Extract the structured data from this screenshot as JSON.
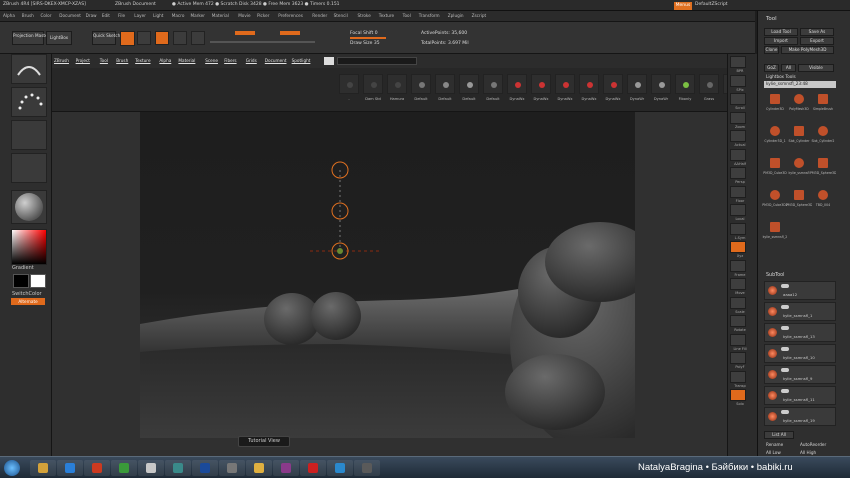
{
  "title_bar": {
    "app": "ZBrush 4R4 [SIRS-DKEX-XMCP-XZAS]",
    "doc": "ZBrush Document",
    "stats": "● Active Mem 472 ● Scratch Disk 3428 ● Free Mem 3623 ● Timers 0.151",
    "menus_button": "Menus",
    "default_script": "DefaultZScript"
  },
  "menu_bar": [
    "Alpha",
    "Brush",
    "Color",
    "Document",
    "Draw",
    "Edit",
    "File",
    "Layer",
    "Light",
    "Macro",
    "Marker",
    "Material",
    "Movie",
    "Picker",
    "Preferences",
    "Render",
    "Stencil",
    "Stroke",
    "Texture",
    "Tool",
    "Transform",
    "Zplugin",
    "Zscript"
  ],
  "toolbar": {
    "projection_master": "Projection Master",
    "lightbox": "LightBox",
    "quick_sketch": "Quick Sketch",
    "edit": "Edit",
    "draw": "Draw",
    "move": "Move",
    "scale": "Scale",
    "rotate": "Rotate",
    "focal_shift": "Focal Shift 0",
    "draw_size": "Draw Size 35",
    "active_points": "ActivePoints: 35,600",
    "total_points": "TotalPoints: 3.697 Mil"
  },
  "sub_palette": [
    "ZBrush",
    "Project",
    "Tool",
    "Brush",
    "Texture",
    "Alpha",
    "Material",
    "Scene",
    "Fibers",
    "Grids",
    "Document",
    "Spotlight"
  ],
  "brushes": [
    {
      "label": "-",
      "color": "#444444"
    },
    {
      "label": "Dam Std",
      "color": "#444444"
    },
    {
      "label": "Hamura",
      "color": "#444444"
    },
    {
      "label": "Default",
      "color": "#777777"
    },
    {
      "label": "Default",
      "color": "#888888"
    },
    {
      "label": "Default",
      "color": "#999999"
    },
    {
      "label": "Default",
      "color": "#777777"
    },
    {
      "label": "DynaWx",
      "color": "#cc3333"
    },
    {
      "label": "DynaWx",
      "color": "#cc3333"
    },
    {
      "label": "DynaWx",
      "color": "#cc3333"
    },
    {
      "label": "DynaWx",
      "color": "#cc3333"
    },
    {
      "label": "DynaWx",
      "color": "#cc3333"
    },
    {
      "label": "DynaWr",
      "color": "#999999"
    },
    {
      "label": "DynaWr",
      "color": "#999999"
    },
    {
      "label": "Fibonly",
      "color": "#7bc043"
    },
    {
      "label": "Grass",
      "color": "#666666"
    },
    {
      "label": "Grass",
      "color": "#666666"
    }
  ],
  "left_shelf": {
    "gradient": "Gradient",
    "switch_color": "SwitchColor",
    "alternate": "Alternate"
  },
  "right_shelf": [
    "BPR",
    "SPix",
    "Scroll",
    "Zoom",
    "Actual",
    "AAHalf",
    "Persp",
    "Floor",
    "Local",
    "L.Sym",
    "Xyz",
    "Frame",
    "Move",
    "Scale",
    "Rotate",
    "Line Fill",
    "PolyF",
    "Transp",
    "Solo"
  ],
  "tray": {
    "title": "Tool",
    "load_tool": "Load Tool",
    "save_as": "Save As",
    "import": "Import",
    "export": "Export",
    "clone": "Clone",
    "make_polymesh": "Make PolyMesh3D",
    "goz": "GoZ",
    "all": "All",
    "visible": "Visible",
    "lightbox_tools": "Lightbox Tools",
    "current_tool": "kylie_ssmnsfl_23:48",
    "tools": [
      "Cylinder3D",
      "PolyMesh3D",
      "SimpleBrush",
      "Cylinder3D_1",
      "Slot_Cylinder",
      "Slot_Cylinder2",
      "PM3D_Cube3D",
      "kylie_ssmnsfl",
      "PM3D_Sphere3D",
      "PM3D_Cube3D2",
      "PM3D_Sphere3D2",
      "TBD_004",
      "kylie_ssmnsfl_2"
    ],
    "subtool": "SubTool",
    "subtools": [
      "aaaa12",
      "kylie_ssmnsfl_1",
      "kylie_ssmnsfl_13",
      "kylie_ssmnsfl_10",
      "kylie_ssmnsfl_9",
      "kylie_ssmnsfl_11",
      "kylie_ssmnsfl_19"
    ],
    "list_all": "List All",
    "rename": "Rename",
    "auto_reorder": "AutoReorder",
    "all_low": "All Low",
    "all_high": "All High"
  },
  "tutorial_view": "Tutorial View",
  "watermark": "NatalyaBragina • Бэйбики • babiki.ru"
}
